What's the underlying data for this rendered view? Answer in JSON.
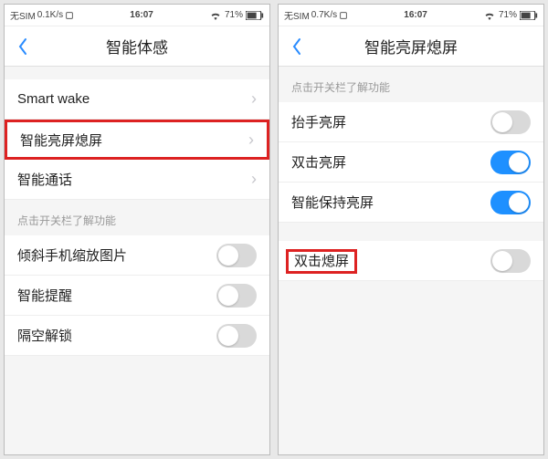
{
  "status": {
    "sim_left": "无SIM",
    "speed_left": "0.1K/s",
    "speed_right_phone": "0.7K/s",
    "time": "16:07",
    "wifi_icon": "wifi",
    "battery_pct": "71%"
  },
  "left": {
    "nav_title": "智能体感",
    "group1": [
      {
        "label": "Smart wake",
        "type": "disclosure",
        "highlight": false
      },
      {
        "label": "智能亮屏熄屏",
        "type": "disclosure",
        "highlight": true
      },
      {
        "label": "智能通话",
        "type": "disclosure",
        "highlight": false
      }
    ],
    "hint": "点击开关栏了解功能",
    "group2": [
      {
        "label": "倾斜手机缩放图片",
        "type": "toggle",
        "on": false
      },
      {
        "label": "智能提醒",
        "type": "toggle",
        "on": false
      },
      {
        "label": "隔空解锁",
        "type": "toggle",
        "on": false
      }
    ]
  },
  "right": {
    "nav_title": "智能亮屏熄屏",
    "hint": "点击开关栏了解功能",
    "group1": [
      {
        "label": "抬手亮屏",
        "type": "toggle",
        "on": false
      },
      {
        "label": "双击亮屏",
        "type": "toggle",
        "on": true
      },
      {
        "label": "智能保持亮屏",
        "type": "toggle",
        "on": true
      }
    ],
    "group2": [
      {
        "label": "双击熄屏",
        "type": "toggle",
        "on": false,
        "highlight": true
      }
    ]
  }
}
